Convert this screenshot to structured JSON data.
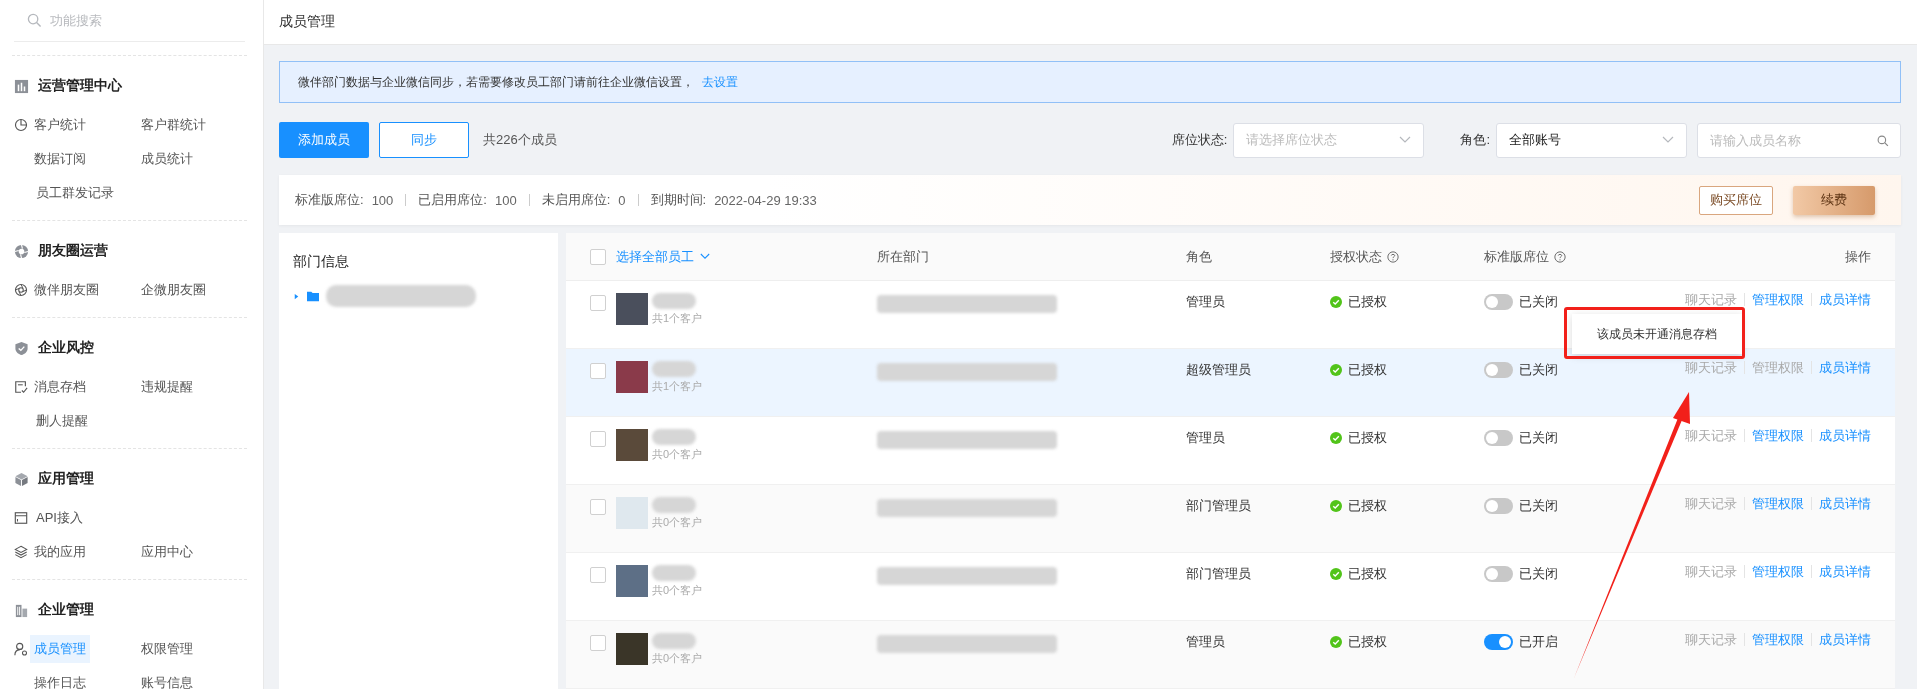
{
  "sidebar": {
    "search": {
      "placeholder": "功能搜索"
    },
    "sections": [
      {
        "title": "运营管理中心",
        "rows": [
          [
            {
              "label": "客户统计",
              "selected": false
            },
            {
              "label": "客户群统计",
              "selected": false
            }
          ],
          [
            {
              "label": "数据订阅",
              "selected": false
            },
            {
              "label": "成员统计",
              "selected": false
            }
          ],
          [
            {
              "label": "员工群发记录",
              "selected": false
            }
          ]
        ]
      },
      {
        "title": "朋友圈运营",
        "rows": [
          [
            {
              "label": "微伴朋友圈",
              "selected": false
            },
            {
              "label": "企微朋友圈",
              "selected": false
            }
          ]
        ]
      },
      {
        "title": "企业风控",
        "rows": [
          [
            {
              "label": "消息存档",
              "selected": false
            },
            {
              "label": "违规提醒",
              "selected": false
            }
          ],
          [
            {
              "label": "删人提醒",
              "selected": false
            }
          ]
        ]
      },
      {
        "title": "应用管理",
        "rows": [
          [
            {
              "label": "API接入",
              "selected": false
            }
          ],
          [
            {
              "label": "我的应用",
              "selected": false
            },
            {
              "label": "应用中心",
              "selected": false
            }
          ]
        ]
      },
      {
        "title": "企业管理",
        "rows": [
          [
            {
              "label": "成员管理",
              "selected": true
            },
            {
              "label": "权限管理",
              "selected": false
            }
          ],
          [
            {
              "label": "操作日志",
              "selected": false
            },
            {
              "label": "账号信息",
              "selected": false
            }
          ]
        ]
      }
    ]
  },
  "page": {
    "title": "成员管理"
  },
  "notice": {
    "text": "微伴部门数据与企业微信同步，若需要修改员工部门请前往企业微信设置，",
    "link": "去设置"
  },
  "toolbar": {
    "add_button": "添加成员",
    "sync_button": "同步",
    "count": "共226个成员",
    "filters": [
      {
        "label": "席位状态:",
        "placeholder": "请选择席位状态"
      },
      {
        "label": "角色:",
        "value": "全部账号"
      }
    ],
    "search": {
      "placeholder": "请输入成员名称"
    }
  },
  "seat_bar": {
    "items": [
      {
        "label": "标准版席位:",
        "value": "100"
      },
      {
        "label": "已启用席位:",
        "value": "100"
      },
      {
        "label": "未启用席位:",
        "value": "0"
      },
      {
        "label": "到期时间:",
        "value": "2022-04-29 19:33"
      }
    ],
    "buy_button": "购买席位",
    "renew_button": "续费"
  },
  "department_panel": {
    "title": "部门信息",
    "tree": [
      {
        "expanded": false
      }
    ]
  },
  "table": {
    "select_all": {
      "label": "选择全部员工",
      "checked": false
    },
    "columns": [
      "所在部门",
      "角色",
      "授权状态",
      "标准版席位",
      "操作"
    ],
    "rows": [
      {
        "checked": false,
        "hovered": false,
        "customers": "共1个客户",
        "role": "管理员",
        "auth": "已授权",
        "seat": {
          "on": false,
          "label": "已关闭"
        },
        "actions": [
          {
            "label": "聊天记录",
            "disabled": true
          },
          {
            "label": "管理权限",
            "disabled": false
          },
          {
            "label": "成员详情",
            "disabled": false
          }
        ]
      },
      {
        "checked": false,
        "hovered": true,
        "customers": "共1个客户",
        "role": "超级管理员",
        "auth": "已授权",
        "seat": {
          "on": false,
          "label": "已关闭"
        },
        "actions": [
          {
            "label": "聊天记录",
            "disabled": true
          },
          {
            "label": "管理权限",
            "disabled": true
          },
          {
            "label": "成员详情",
            "disabled": false
          }
        ]
      },
      {
        "checked": false,
        "hovered": false,
        "customers": "共0个客户",
        "role": "管理员",
        "auth": "已授权",
        "seat": {
          "on": false,
          "label": "已关闭"
        },
        "actions": [
          {
            "label": "聊天记录",
            "disabled": true
          },
          {
            "label": "管理权限",
            "disabled": false
          },
          {
            "label": "成员详情",
            "disabled": false
          }
        ]
      },
      {
        "checked": false,
        "hovered": false,
        "customers": "共0个客户",
        "role": "部门管理员",
        "auth": "已授权",
        "seat": {
          "on": false,
          "label": "已关闭"
        },
        "actions": [
          {
            "label": "聊天记录",
            "disabled": true
          },
          {
            "label": "管理权限",
            "disabled": false
          },
          {
            "label": "成员详情",
            "disabled": false
          }
        ]
      },
      {
        "checked": false,
        "hovered": false,
        "customers": "共0个客户",
        "role": "部门管理员",
        "auth": "已授权",
        "seat": {
          "on": false,
          "label": "已关闭"
        },
        "actions": [
          {
            "label": "聊天记录",
            "disabled": true
          },
          {
            "label": "管理权限",
            "disabled": false
          },
          {
            "label": "成员详情",
            "disabled": false
          }
        ]
      },
      {
        "checked": false,
        "hovered": false,
        "customers": "共0个客户",
        "role": "管理员",
        "auth": "已授权",
        "seat": {
          "on": true,
          "label": "已开启"
        },
        "actions": [
          {
            "label": "聊天记录",
            "disabled": true
          },
          {
            "label": "管理权限",
            "disabled": false
          },
          {
            "label": "成员详情",
            "disabled": false
          }
        ]
      }
    ],
    "tooltip": "该成员未开通消息存档"
  }
}
